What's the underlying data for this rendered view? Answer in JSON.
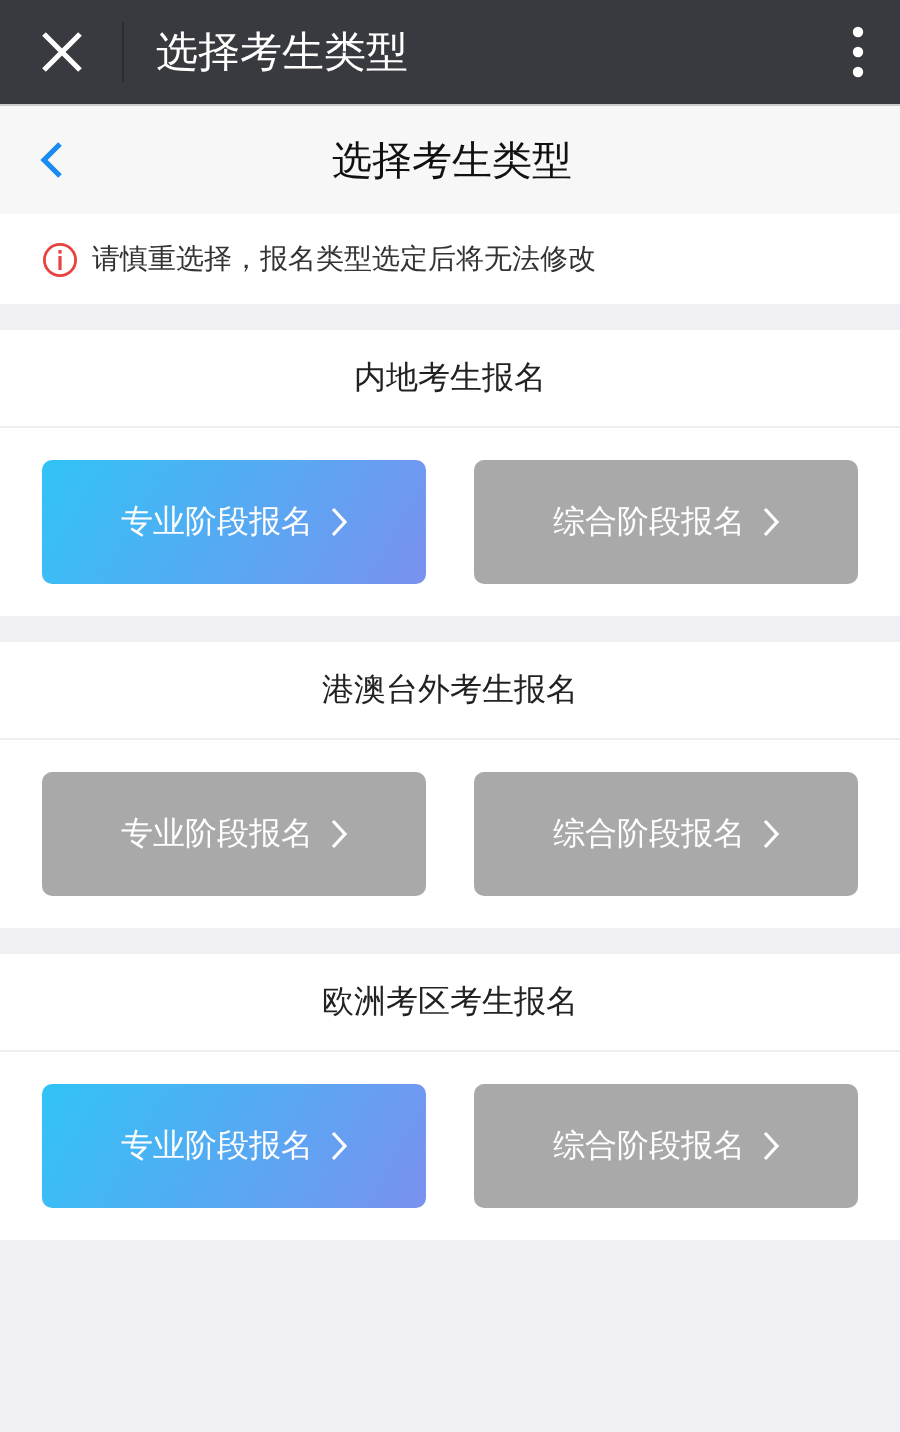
{
  "window": {
    "title": "选择考生类型"
  },
  "nav": {
    "title": "选择考生类型"
  },
  "notice": "请慎重选择，报名类型选定后将无法修改",
  "sections": [
    {
      "title": "内地考生报名",
      "buttons": [
        {
          "label": "专业阶段报名",
          "disabled": false
        },
        {
          "label": "综合阶段报名",
          "disabled": true
        }
      ]
    },
    {
      "title": "港澳台外考生报名",
      "buttons": [
        {
          "label": "专业阶段报名",
          "disabled": true
        },
        {
          "label": "综合阶段报名",
          "disabled": true
        }
      ]
    },
    {
      "title": "欧洲考区考生报名",
      "buttons": [
        {
          "label": "专业阶段报名",
          "disabled": false
        },
        {
          "label": "综合阶段报名",
          "disabled": true
        }
      ]
    }
  ]
}
